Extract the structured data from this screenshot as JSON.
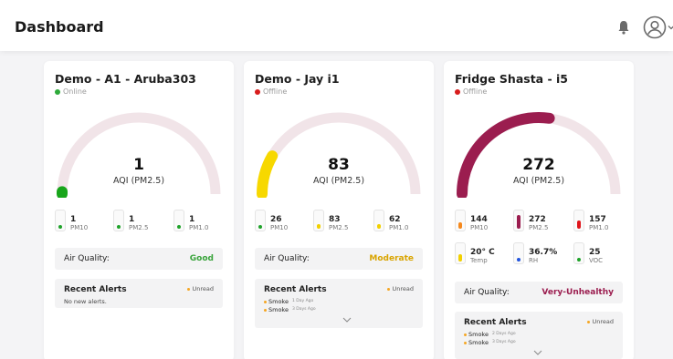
{
  "header": {
    "title": "Dashboard"
  },
  "colors": {
    "online": "#2eaa3a",
    "offline": "#d81c1c",
    "good": "#3aa43c",
    "moderate": "#d9a400",
    "unhealthy": "#9b1d4f",
    "track": "#f1e4e8"
  },
  "cards": [
    {
      "title": "Demo - A1 - Aruba303",
      "status": "Online",
      "status_color": "#2eaa3a",
      "aqi": "1",
      "aqi_label": "AQI (PM2.5)",
      "gauge_fraction": 0.005,
      "gauge_color": "#18a51b",
      "metrics": [
        {
          "value": "1",
          "label": "PM10",
          "color": "#1fa32a",
          "level": 0.18
        },
        {
          "value": "1",
          "label": "PM2.5",
          "color": "#1fa32a",
          "level": 0.18
        },
        {
          "value": "1",
          "label": "PM1.0",
          "color": "#1fa32a",
          "level": 0.18
        }
      ],
      "air_quality_label": "Air Quality:",
      "air_quality": "Good",
      "air_quality_color": "#3aa43c",
      "alerts_title": "Recent Alerts",
      "unread_label": "Unread",
      "no_alerts": "No new alerts.",
      "alerts": []
    },
    {
      "title": "Demo - Jay i1",
      "status": "Offline",
      "status_color": "#d81c1c",
      "aqi": "83",
      "aqi_label": "AQI (PM2.5)",
      "gauge_fraction": 0.166,
      "gauge_color": "#f7d800",
      "metrics": [
        {
          "value": "26",
          "label": "PM10",
          "color": "#1fa32a",
          "level": 0.18
        },
        {
          "value": "83",
          "label": "PM2.5",
          "color": "#f2d000",
          "level": 0.3
        },
        {
          "value": "62",
          "label": "PM1.0",
          "color": "#f2d000",
          "level": 0.3
        }
      ],
      "air_quality_label": "Air Quality:",
      "air_quality": "Moderate",
      "air_quality_color": "#d9a400",
      "alerts_title": "Recent Alerts",
      "unread_label": "Unread",
      "no_alerts": "",
      "alerts": [
        {
          "name": "Smoke",
          "ago": "1 Day Ago"
        },
        {
          "name": "Smoke",
          "ago": "3 Days Ago"
        }
      ]
    },
    {
      "title": "Fridge Shasta - i5",
      "status": "Offline",
      "status_color": "#d81c1c",
      "aqi": "272",
      "aqi_label": "AQI (PM2.5)",
      "gauge_fraction": 0.544,
      "gauge_color": "#9b1d4f",
      "metrics": [
        {
          "value": "144",
          "label": "PM10",
          "color": "#f5891d",
          "level": 0.4
        },
        {
          "value": "272",
          "label": "PM2.5",
          "color": "#9b1d4f",
          "level": 0.85
        },
        {
          "value": "157",
          "label": "PM1.0",
          "color": "#e0151b",
          "level": 0.5
        },
        {
          "value": "20° C",
          "label": "Temp",
          "color": "#f2d000",
          "level": 0.45
        },
        {
          "value": "36.7%",
          "label": "RH",
          "color": "#2255dd",
          "level": 0.22
        },
        {
          "value": "25",
          "label": "VOC",
          "color": "#1fa32a",
          "level": 0.18
        }
      ],
      "air_quality_label": "Air Quality:",
      "air_quality": "Very-Unhealthy",
      "air_quality_color": "#9b1d4f",
      "alerts_title": "Recent Alerts",
      "unread_label": "Unread",
      "no_alerts": "",
      "alerts": [
        {
          "name": "Smoke",
          "ago": "2 Days Ago"
        },
        {
          "name": "Smoke",
          "ago": "3 Days Ago"
        }
      ]
    }
  ]
}
